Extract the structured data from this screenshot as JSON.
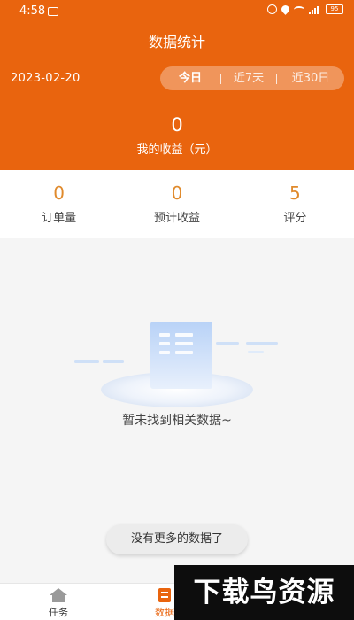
{
  "status_bar": {
    "time": "4:58",
    "battery": "95"
  },
  "header": {
    "title": "数据统计",
    "date": "2023-02-20",
    "tabs": [
      {
        "label": "今日",
        "active": true
      },
      {
        "label": "近7天",
        "active": false
      },
      {
        "label": "近30日",
        "active": false
      }
    ],
    "income_value": "0",
    "income_label": "我的收益（元）"
  },
  "stats": [
    {
      "value": "0",
      "label": "订单量"
    },
    {
      "value": "0",
      "label": "预计收益"
    },
    {
      "value": "5",
      "label": "评分"
    }
  ],
  "empty_state": {
    "message": "暂未找到相关数据~"
  },
  "no_more_label": "没有更多的数据了",
  "bottom_nav": {
    "items": [
      {
        "label": "任务",
        "icon": "home-icon",
        "active": false
      },
      {
        "label": "数据",
        "icon": "data-icon",
        "active": true
      }
    ]
  },
  "watermark": "下载鸟资源",
  "colors": {
    "accent": "#e9640e",
    "stat_value": "#e08a2c",
    "background": "#f5f5f5"
  }
}
